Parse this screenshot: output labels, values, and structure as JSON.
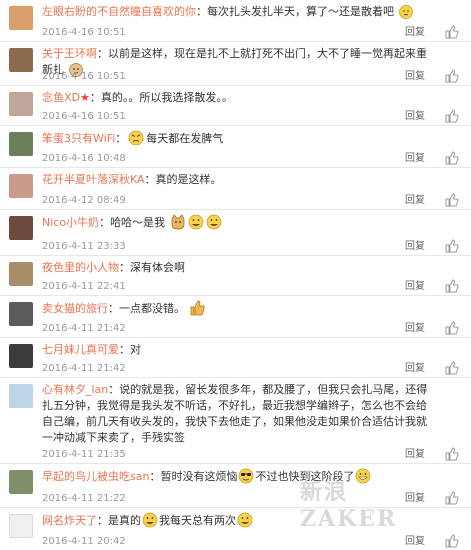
{
  "comments": [
    {
      "user": "左眼右盼的不自然瞳自喜欢的你",
      "text": "每次扎头发扎半天，算了～还是散着吧",
      "date": "2016-4-16 10:51",
      "reply": "回复",
      "avatar_color": "#d9a06b"
    },
    {
      "user": "关于王环啊",
      "text": "以前是这样，现在是扎不上就打死不出门，大不了睡一觉再起来重新扎",
      "date": "2016-4-16 10:51",
      "reply": "回复",
      "avatar_color": "#8c6b4e"
    },
    {
      "user": "念鱼XD",
      "text": "真的。。所以我选择散发。。",
      "date": "2016-4-16 10:51",
      "reply": "回复",
      "avatar_color": "#bfa59a"
    },
    {
      "user": "笨蛋3只有WiFi",
      "text": "每天都在发脾气",
      "date": "2016-4-16 10:48",
      "reply": "回复",
      "avatar_color": "#6a7f5a"
    },
    {
      "user": "花开半夏叶落深秋KA",
      "text": "真的是这样。",
      "date": "2016-4-12 08:49",
      "reply": "回复",
      "avatar_color": "#c99b8a"
    },
    {
      "user": "Nico小牛奶",
      "text": "哈哈～是我",
      "date": "2016-4-11 23:33",
      "reply": "回复",
      "avatar_color": "#6e4a3c"
    },
    {
      "user": "夜色里的小人物",
      "text": "深有体会啊",
      "date": "2016-4-11 22:41",
      "reply": "回复",
      "avatar_color": "#a88d6a"
    },
    {
      "user": "卖女猫的旅行",
      "text": "一点都没错。",
      "date": "2016-4-11 21:42",
      "reply": "回复",
      "avatar_color": "#5a5a5a"
    },
    {
      "user": "七月妹儿真可爱",
      "text": "对",
      "date": "2016-4-11 21:42",
      "reply": "回复",
      "avatar_color": "#3b3b3b"
    },
    {
      "user": "心有林夕_lan",
      "text": "说的就是我，留长发很多年，都及腰了，但我只会扎马尾，还得扎五分钟，我觉得是我头发不听话，不好扎，最近我想学编辫子，怎么也不会给自己编，前几天有收头发的，我快下去他走了，如果他没走如果价合适估计我就一冲动减下来卖了，手残实签",
      "date": "2016-4-11 21:35",
      "reply": "回复",
      "avatar_color": "#bcd6e6"
    },
    {
      "user": "早起的鸟儿被虫吃san",
      "text": "暂时没有这烦恼",
      "text2": "不过也快到这阶段了",
      "date": "2016-4-11 21:22",
      "reply": "回复",
      "avatar_color": "#7f8f6a"
    },
    {
      "user": "网名炸天了",
      "text": "是真的",
      "text2": "我每天总有两次",
      "date": "2016-4-11 20:42",
      "reply": "回复",
      "avatar_color": "#f0f0f0"
    }
  ],
  "watermark": "新浪ZAKER",
  "colors": {
    "username": "#eb7350",
    "meta": "#999999",
    "divider": "#e8e8e8"
  }
}
